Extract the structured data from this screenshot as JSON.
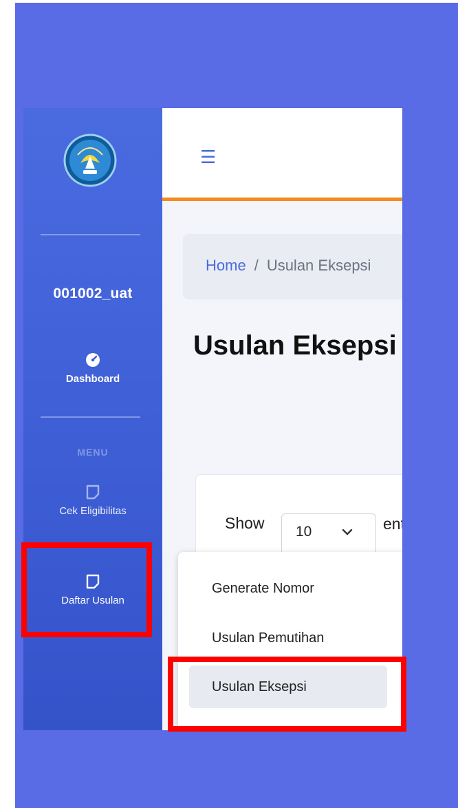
{
  "sidebar": {
    "username": "001002_uat",
    "dashboard_label": "Dashboard",
    "menu_heading": "MENU",
    "items": [
      {
        "label": "Cek Eligibilitas",
        "icon": "note-icon"
      },
      {
        "label": "Daftar Usulan",
        "icon": "note-icon"
      }
    ]
  },
  "breadcrumb": {
    "home": "Home",
    "separator": "/",
    "current": "Usulan Eksepsi"
  },
  "page": {
    "title": "Usulan Eksepsi"
  },
  "table_controls": {
    "show_label": "Show",
    "page_size": "10",
    "entries_label": "entries"
  },
  "dropdown": {
    "items": [
      "Generate Nomor",
      "Usulan Pemutihan",
      "Usulan Eksepsi"
    ],
    "active_index": 2
  },
  "colors": {
    "accent": "#4a6be0",
    "topbar_border": "#f58a1f",
    "highlight": "#ff0000",
    "frame_bg": "#5a6be6"
  }
}
